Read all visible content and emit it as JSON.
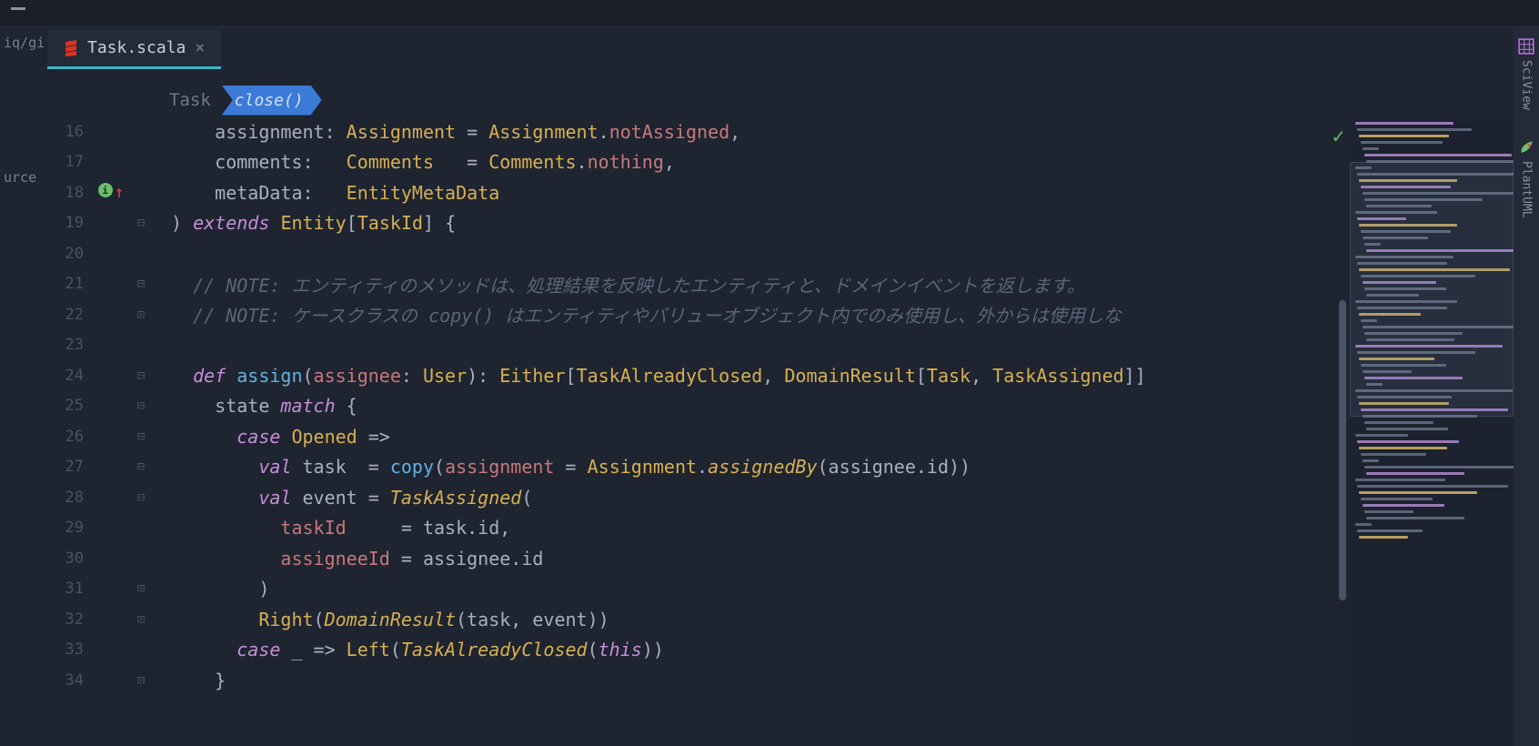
{
  "left_sidebar": {
    "items": [
      "iq/gi",
      "urce"
    ]
  },
  "tab": {
    "filename": "Task.scala",
    "close_glyph": "×"
  },
  "breadcrumb": {
    "parent": "Task",
    "current": "close()"
  },
  "status": {
    "ok_glyph": "✓"
  },
  "right_tools": [
    {
      "label": "SciView",
      "icon": "grid"
    },
    {
      "label": "PlantUML",
      "icon": "leaf"
    }
  ],
  "gutter": {
    "line18_marker": "i"
  },
  "code_lines": [
    {
      "num": "16",
      "fold": "",
      "html": "<span class='id'>    assignment</span><span class='punct'>: </span><span class='type'>Assignment</span><span class='punct'> = </span><span class='type'>Assignment</span><span class='punct'>.</span><span class='prop'>notAssigned</span><span class='punct'>,</span>"
    },
    {
      "num": "17",
      "fold": "",
      "html": "<span class='id'>    comments</span><span class='punct'>:   </span><span class='type'>Comments</span><span class='punct'>   = </span><span class='type'>Comments</span><span class='punct'>.</span><span class='prop'>nothing</span><span class='punct'>,</span>"
    },
    {
      "num": "18",
      "fold": "",
      "html": "<span class='id'>    metaData</span><span class='punct'>:   </span><span class='type'>EntityMetaData</span>"
    },
    {
      "num": "19",
      "fold": "⊟",
      "html": "<span class='punct'>) </span><span class='kw'>extends</span><span class='punct'> </span><span class='type'>Entity</span><span class='punct'>[</span><span class='type'>TaskId</span><span class='punct'>] {</span>"
    },
    {
      "num": "20",
      "fold": "",
      "html": ""
    },
    {
      "num": "21",
      "fold": "⊟",
      "html": "<span class='comment'>  // NOTE: エンティティのメソッドは、処理結果を反映したエンティティと、ドメインイベントを返します。</span>"
    },
    {
      "num": "22",
      "fold": "⊡",
      "html": "<span class='comment'>  // NOTE: ケースクラスの copy() はエンティティやバリューオブジェクト内でのみ使用し、外からは使用しな</span>"
    },
    {
      "num": "23",
      "fold": "",
      "html": ""
    },
    {
      "num": "24",
      "fold": "⊟",
      "html": "<span class='kw'>  def </span><span class='fn'>assign</span><span class='punct'>(</span><span class='param'>assignee</span><span class='punct'>: </span><span class='type'>User</span><span class='punct'>): </span><span class='type'>Either</span><span class='punct'>[</span><span class='type'>TaskAlreadyClosed</span><span class='punct'>, </span><span class='type'>DomainResult</span><span class='punct'>[</span><span class='type'>Task</span><span class='punct'>, </span><span class='type'>TaskAssigned</span><span class='punct'>]]</span>"
    },
    {
      "num": "25",
      "fold": "⊟",
      "html": "<span class='id'>    state </span><span class='kw'>match</span><span class='punct'> {</span>"
    },
    {
      "num": "26",
      "fold": "⊟",
      "html": "<span class='kw2'>      case </span><span class='type'>Opened</span><span class='punct'> =></span>"
    },
    {
      "num": "27",
      "fold": "⊟",
      "html": "<span class='val'>        val </span><span class='id'>task  </span><span class='punct'>= </span><span class='call'>copy</span><span class='punct'>(</span><span class='param'>assignment</span><span class='punct'> = </span><span class='type'>Assignment</span><span class='punct'>.</span><span class='type2'>assignedBy</span><span class='punct'>(assignee.id))</span>"
    },
    {
      "num": "28",
      "fold": "⊟",
      "html": "<span class='val'>        val </span><span class='id'>event </span><span class='punct'>= </span><span class='type2'>TaskAssigned</span><span class='punct'>(</span>"
    },
    {
      "num": "29",
      "fold": "",
      "html": "<span class='param'>          taskId     </span><span class='punct'>= task.id,</span>"
    },
    {
      "num": "30",
      "fold": "",
      "html": "<span class='param'>          assigneeId </span><span class='punct'>= assignee.id</span>"
    },
    {
      "num": "31",
      "fold": "⊡",
      "html": "<span class='punct'>        )</span>"
    },
    {
      "num": "32",
      "fold": "⊡",
      "html": "<span class='type'>        Right</span><span class='punct'>(</span><span class='type2'>DomainResult</span><span class='punct'>(task, event))</span>"
    },
    {
      "num": "33",
      "fold": "",
      "html": "<span class='kw2'>      case </span><span class='punct'>_ => </span><span class='type'>Left</span><span class='punct'>(</span><span class='type2'>TaskAlreadyClosed</span><span class='punct'>(</span><span class='this'>this</span><span class='punct'>))</span>"
    },
    {
      "num": "34",
      "fold": "⊡",
      "html": "<span class='punct'>    }</span>"
    }
  ]
}
